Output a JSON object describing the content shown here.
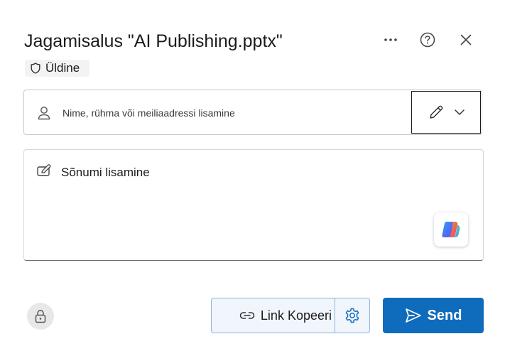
{
  "dialog": {
    "title": "Jagamisalus \"AI Publishing.pptx\"",
    "sensitivity_label": "Üldine"
  },
  "header_actions": {
    "more_icon": "more-horizontal-icon",
    "help_icon": "question-circle-icon",
    "close_icon": "close-icon"
  },
  "recipients": {
    "placeholder": "Nime, rühma või meiliaadressi lisamine",
    "value": "",
    "permission_icon": "pencil-icon"
  },
  "message": {
    "placeholder": "Sõnumi lisamine",
    "value": ""
  },
  "footer": {
    "copy_link_label": "Link Kopeeri",
    "send_label": "Send"
  },
  "colors": {
    "accent": "#0f6cbd",
    "link_group_bg": "#f1f6fc",
    "link_group_border": "#8fb3dd"
  }
}
